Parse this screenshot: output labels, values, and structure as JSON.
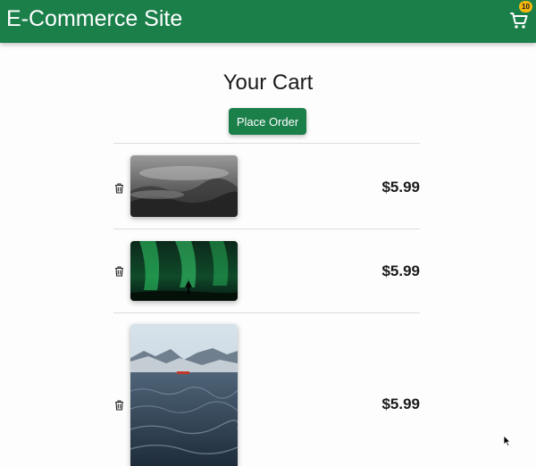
{
  "header": {
    "brand": "E-Commerce Site",
    "cart_icon": "shopping-cart-icon",
    "cart_count": "10",
    "bg_color": "#1b7f4a",
    "badge_color": "#f5b70f"
  },
  "cart": {
    "title": "Your Cart",
    "place_order_label": "Place Order",
    "items": [
      {
        "image": "misty-forest-photo",
        "price": "$5.99",
        "remove_icon": "trash-icon"
      },
      {
        "image": "aurora-borealis-photo",
        "price": "$5.99",
        "remove_icon": "trash-icon"
      },
      {
        "image": "fjord-sea-photo",
        "price": "$5.99",
        "remove_icon": "trash-icon"
      }
    ]
  }
}
